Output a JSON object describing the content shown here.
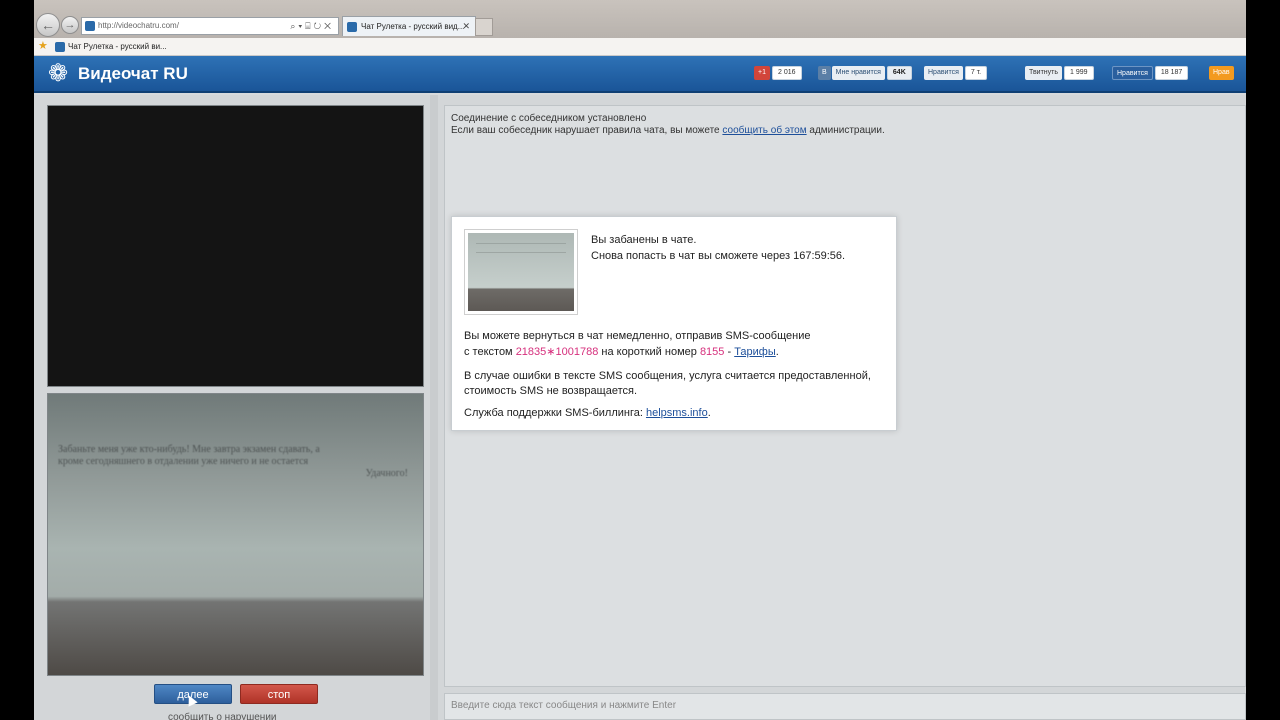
{
  "browser": {
    "url": "http://videochatru.com/",
    "tab_title": "Чат Рулетка - русский вид...",
    "favorites_item": "Чат Рулетка - русский ви..."
  },
  "site": {
    "logo": "Видеочат RU",
    "social": {
      "gplus_label": "+1",
      "gplus_count": "2 016",
      "vk_label": "Мне нравится",
      "vk_count": "64K",
      "fb_label": "Нравится",
      "fb_count": "7 т.",
      "tw_label": "Твитнуть",
      "tw_count": "1 999",
      "mm_label": "Нравится",
      "mm_count": "18 187",
      "ok_label": "Нрав"
    }
  },
  "local_video_note": [
    "Забаньте меня уже кто-нибудь! Мне завтра экзамен сдавать, а",
    "кроме сегодняшнего в отдалении уже ничего и не остается",
    "Удачного!"
  ],
  "controls": {
    "next_label": "далее",
    "stop_label": "стоп",
    "below_link": "сообщить о нарушении"
  },
  "chat": {
    "msg_connected": "Соединение с собеседником установлено",
    "msg_rules_prefix": "Если ваш собеседник нарушает правила чата, вы можете ",
    "msg_rules_link": "сообщить об этом",
    "msg_rules_suffix": " администрации.",
    "input_placeholder": "Введите сюда текст сообщения и нажмите Enter"
  },
  "modal": {
    "banned": "Вы забанены в чате.",
    "retry": "Снова попасть в чат вы сможете через 167:59:56.",
    "sms_line1": "Вы можете вернуться в чат немедленно, отправив SMS-сообщение",
    "sms_prefix": "с текстом ",
    "sms_code": "21835∗1001788",
    "sms_mid": " на короткий номер ",
    "sms_number": "8155",
    "sms_dash": " - ",
    "tariffs_link": "Тарифы",
    "period": ".",
    "error_line1": "В случае ошибки в тексте SMS сообщения, услуга считается предоставленной,",
    "error_line2": "стоимость SMS не возвращается.",
    "support_prefix": "Служба поддержки SMS-биллинга: ",
    "support_link": "helpsms.info",
    "support_suffix": "."
  },
  "colors": {
    "header_blue": "#1f5c9f",
    "next_button": "#2d5f9c",
    "stop_button": "#b03327",
    "sms_highlight": "#d6307d"
  }
}
